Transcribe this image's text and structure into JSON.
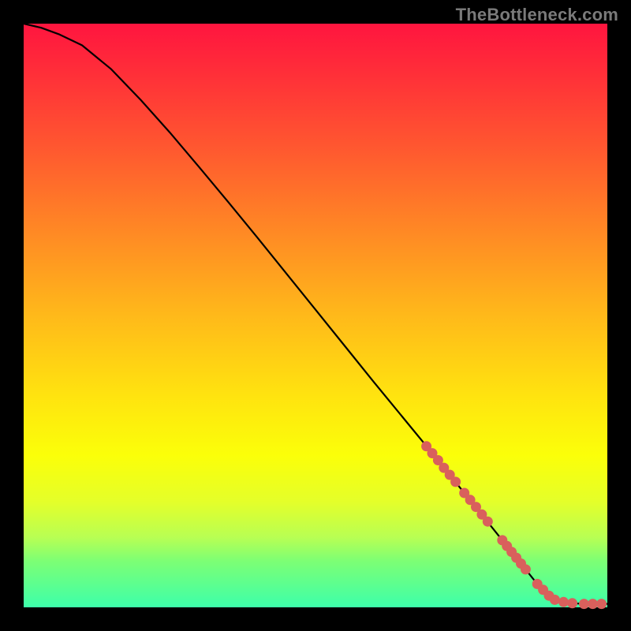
{
  "watermark": "TheBottleneck.com",
  "colors": {
    "background": "#000000",
    "line": "#000000",
    "marker": "#d9605c"
  },
  "chart_data": {
    "type": "line",
    "title": "",
    "xlabel": "",
    "ylabel": "",
    "xlim": [
      0,
      100
    ],
    "ylim": [
      0,
      100
    ],
    "grid": false,
    "legend": false,
    "series": [
      {
        "name": "curve",
        "x": [
          0,
          3,
          6,
          10,
          15,
          20,
          25,
          30,
          35,
          40,
          45,
          50,
          55,
          60,
          65,
          70,
          75,
          80,
          82,
          84,
          86,
          88,
          90,
          92,
          94,
          96,
          98,
          100
        ],
        "y": [
          100,
          99.3,
          98.2,
          96.3,
          92.2,
          87.0,
          81.4,
          75.5,
          69.5,
          63.4,
          57.2,
          51.0,
          44.8,
          38.6,
          32.5,
          26.4,
          20.2,
          14.0,
          11.5,
          9.0,
          6.5,
          4.0,
          2.0,
          1.0,
          0.7,
          0.6,
          0.6,
          0.6
        ]
      }
    ],
    "markers": {
      "name": "highlight-points",
      "x": [
        69,
        70,
        71,
        72,
        73,
        74,
        75.5,
        76.5,
        77.5,
        78.5,
        79.5,
        82,
        82.8,
        83.6,
        84.4,
        85.2,
        86,
        88,
        89,
        90,
        91,
        92.5,
        94,
        96,
        97.5,
        99
      ],
      "y": [
        27.6,
        26.4,
        25.2,
        23.9,
        22.7,
        21.5,
        19.6,
        18.4,
        17.2,
        15.9,
        14.7,
        11.5,
        10.5,
        9.5,
        8.5,
        7.5,
        6.5,
        4.0,
        3.0,
        2.0,
        1.3,
        0.9,
        0.7,
        0.6,
        0.6,
        0.6
      ]
    }
  }
}
